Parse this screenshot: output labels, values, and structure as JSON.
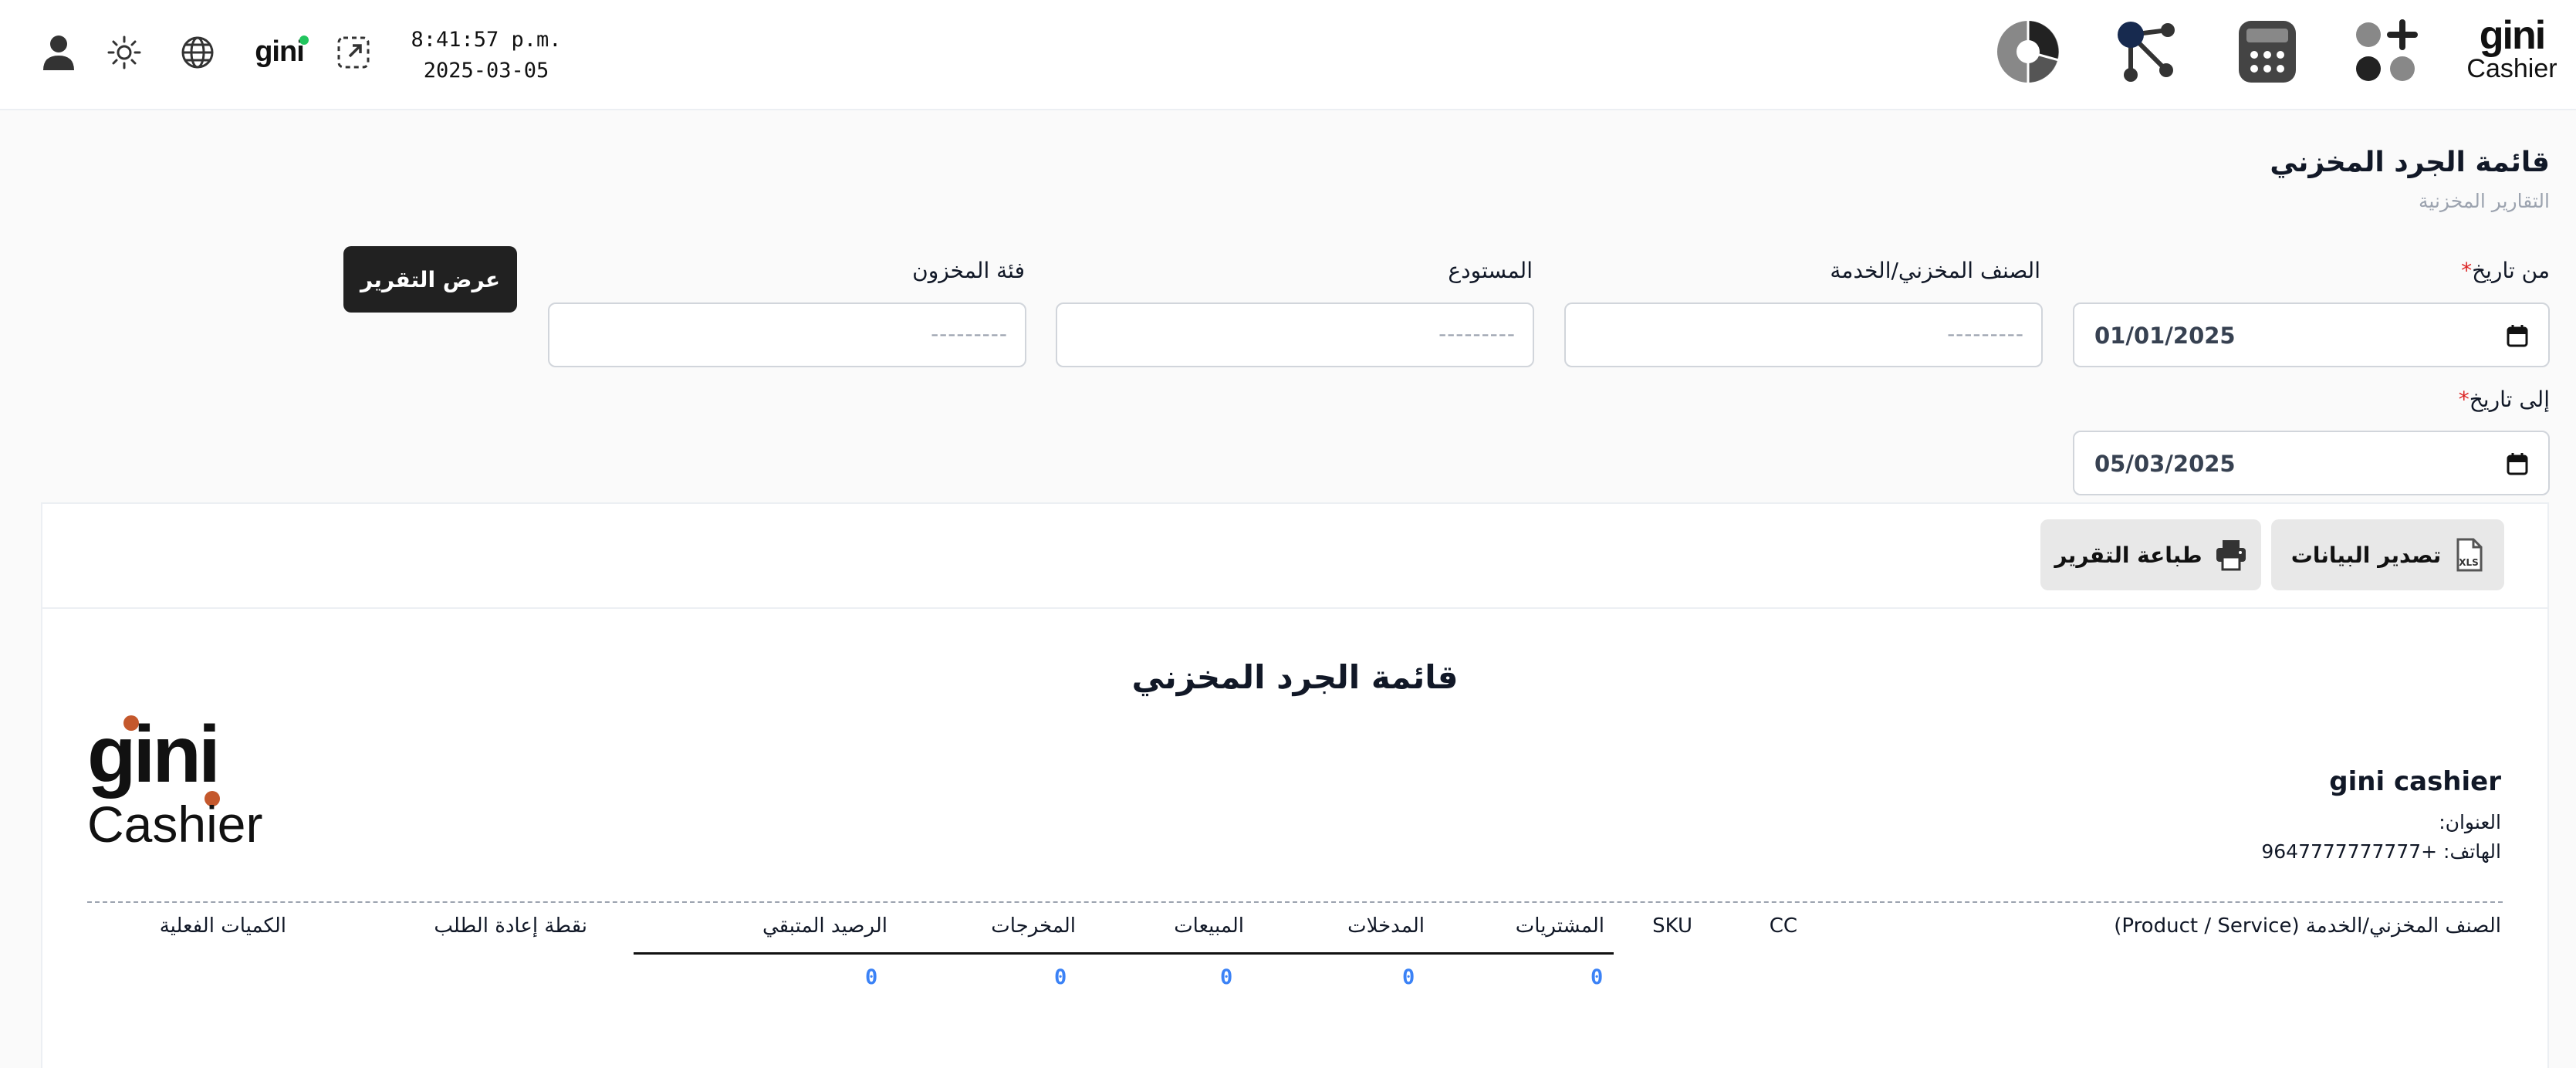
{
  "topbar": {
    "time": "8:41:57 p.m.",
    "date": "2025-03-05",
    "brand_small": "gini",
    "logo_top": {
      "line1": "gini",
      "line2": "Cashier"
    }
  },
  "header": {
    "title": "قائمة الجرد المخزني",
    "subtitle": "التقارير المخزنية"
  },
  "form": {
    "from_date_label": "من تاريخ",
    "from_date_value": "01/01/2025",
    "to_date_label": "إلى تاريخ",
    "to_date_value": "05/03/2025",
    "item_label": "الصنف المخزني/الخدمة",
    "warehouse_label": "المستودع",
    "category_label": "فئة المخزون",
    "placeholder": "---------",
    "submit_label": "عرض التقرير",
    "required_mark": "*"
  },
  "toolbar": {
    "export_label": "تصدير البيانات",
    "print_label": "طباعة التقرير"
  },
  "report": {
    "title": "قائمة الجرد المخزني",
    "company_name": "gini cashier",
    "address_label": "العنوان:",
    "phone_label": "الهاتف: +9647777777777",
    "logo": {
      "line1": "gini",
      "line2": "Cashier"
    },
    "columns": {
      "item": "الصنف المخزني/الخدمة (Product / Service)",
      "cc": "CC",
      "sku": "SKU",
      "purchases": "المشتريات",
      "inputs": "المدخلات",
      "sales": "المبيعات",
      "outputs": "المخرجات",
      "balance": "الرصيد المتبقي",
      "reorder": "نقطة إعادة الطلب",
      "actual": "الكميات الفعلية"
    },
    "totals": {
      "purchases": "0",
      "inputs": "0",
      "sales": "0",
      "outputs": "0",
      "balance": "0"
    }
  },
  "icons": {
    "user": "user-icon",
    "theme": "sun-icon",
    "language": "globe-icon",
    "fullscreen": "expand-icon",
    "reports": "pie-chart-icon",
    "network": "network-icon",
    "pos": "calculator-icon",
    "apps": "apps-plus-icon"
  },
  "colors": {
    "accent_dark": "#212121",
    "required": "#dc2626",
    "value_blue": "#3b82f6",
    "logo_dot": "#c4582c",
    "status_green": "#22c55e"
  }
}
